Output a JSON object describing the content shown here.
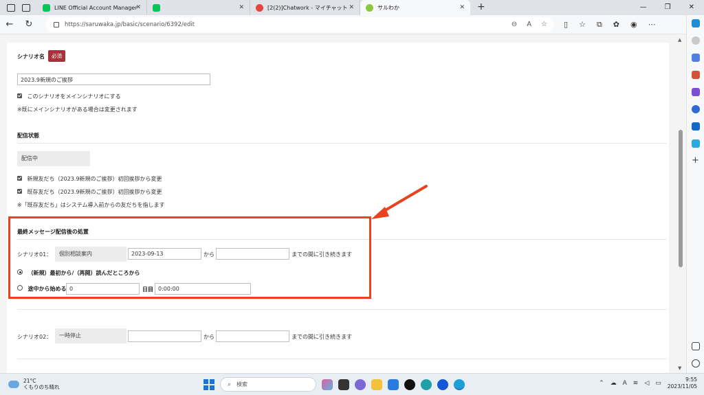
{
  "browser": {
    "tabs": [
      {
        "title": "LINE Official Account Manager",
        "favicon": "line-icon"
      },
      {
        "title": "",
        "favicon": "line-icon"
      },
      {
        "title": "[2(2)]Chatwork - マイチャット",
        "favicon": "chatwork-icon"
      },
      {
        "title": "サルわか",
        "favicon": "saruwaka-icon"
      }
    ],
    "url": "https://saruwaka.jp/basic/scenario/6392/edit"
  },
  "form": {
    "scenario_name_label": "シナリオ名",
    "required_badge": "必須",
    "scenario_name_value": "2023.9新規のご挨拶",
    "main_scenario_checkbox": "このシナリオをメインシナリオにする",
    "main_scenario_note": "※既にメインシナリオがある場合は変更されます",
    "delivery_status_label": "配信状態",
    "delivery_status_value": "配信中",
    "new_friends_checkbox": "新規友だち（2023.9新規のご挨拶）初回挨拶から変更",
    "existing_friends_checkbox": "既存友だち（2023.9新規のご挨拶）初回挨拶から変更",
    "existing_friends_note": "※「既存友だち」はシステム導入前からの友だちを指します",
    "after_last_label": "最終メッセージ配信後の処置",
    "scenario01_label": "シナリオ01：",
    "scenario01_name": "個別相談案内",
    "scenario01_date": "2023-09-13",
    "from_text": "から",
    "until_text": "までの間に引き続きます",
    "radio_restart": "（新規）最初から/（再開）読んだところから",
    "radio_midway": "途中から始める",
    "midway_day_value": "0",
    "day_label": "日目",
    "midway_time_value": "0:00:00",
    "scenario02_label": "シナリオ02：",
    "scenario02_name": "一時停止",
    "scenario02_date": ""
  },
  "taskbar": {
    "temperature": "21°C",
    "weather": "くもりのち晴れ",
    "search_placeholder": "検索",
    "time": "9:55",
    "date": "2023/11/05"
  },
  "colors": {
    "highlight": "#e8421e",
    "required_badge": "#a8323b"
  }
}
